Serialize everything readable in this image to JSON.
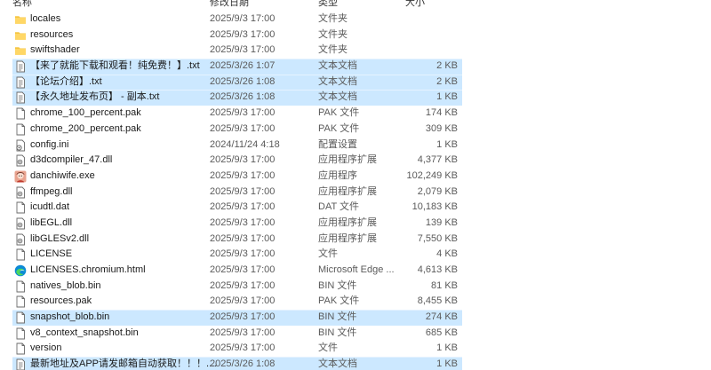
{
  "header": {
    "name_label": "名称",
    "date_label": "修改日期",
    "type_label": "类型",
    "size_label": "大小"
  },
  "colors": {
    "selection": "#cce8ff",
    "folder": "#f5c542",
    "text_secondary": "#5a5a5a"
  },
  "files": [
    {
      "name": "locales",
      "date": "2025/9/3 17:00",
      "type": "文件夹",
      "size": "",
      "icon": "folder-icon",
      "selected": false
    },
    {
      "name": "resources",
      "date": "2025/9/3 17:00",
      "type": "文件夹",
      "size": "",
      "icon": "folder-icon",
      "selected": false
    },
    {
      "name": "swiftshader",
      "date": "2025/9/3 17:00",
      "type": "文件夹",
      "size": "",
      "icon": "folder-icon",
      "selected": false
    },
    {
      "name": "【来了就能下载和观看！纯免费！】.txt",
      "date": "2025/3/26 1:07",
      "type": "文本文档",
      "size": "2 KB",
      "icon": "text-file-icon",
      "selected": true
    },
    {
      "name": "【论坛介绍】.txt",
      "date": "2025/3/26 1:08",
      "type": "文本文档",
      "size": "2 KB",
      "icon": "text-file-icon",
      "selected": true
    },
    {
      "name": "【永久地址发布页】 - 副本.txt",
      "date": "2025/3/26 1:08",
      "type": "文本文档",
      "size": "1 KB",
      "icon": "text-file-icon",
      "selected": true
    },
    {
      "name": "chrome_100_percent.pak",
      "date": "2025/9/3 17:00",
      "type": "PAK 文件",
      "size": "174 KB",
      "icon": "file-icon",
      "selected": false
    },
    {
      "name": "chrome_200_percent.pak",
      "date": "2025/9/3 17:00",
      "type": "PAK 文件",
      "size": "309 KB",
      "icon": "file-icon",
      "selected": false
    },
    {
      "name": "config.ini",
      "date": "2024/11/24 4:18",
      "type": "配置设置",
      "size": "1 KB",
      "icon": "config-file-icon",
      "selected": false
    },
    {
      "name": "d3dcompiler_47.dll",
      "date": "2025/9/3 17:00",
      "type": "应用程序扩展",
      "size": "4,377 KB",
      "icon": "dll-icon",
      "selected": false
    },
    {
      "name": "danchiwife.exe",
      "date": "2025/9/3 17:00",
      "type": "应用程序",
      "size": "102,249 KB",
      "icon": "app-icon",
      "selected": false
    },
    {
      "name": "ffmpeg.dll",
      "date": "2025/9/3 17:00",
      "type": "应用程序扩展",
      "size": "2,079 KB",
      "icon": "dll-icon",
      "selected": false
    },
    {
      "name": "icudtl.dat",
      "date": "2025/9/3 17:00",
      "type": "DAT 文件",
      "size": "10,183 KB",
      "icon": "file-icon",
      "selected": false
    },
    {
      "name": "libEGL.dll",
      "date": "2025/9/3 17:00",
      "type": "应用程序扩展",
      "size": "139 KB",
      "icon": "dll-icon",
      "selected": false
    },
    {
      "name": "libGLESv2.dll",
      "date": "2025/9/3 17:00",
      "type": "应用程序扩展",
      "size": "7,550 KB",
      "icon": "dll-icon",
      "selected": false
    },
    {
      "name": "LICENSE",
      "date": "2025/9/3 17:00",
      "type": "文件",
      "size": "4 KB",
      "icon": "file-icon",
      "selected": false
    },
    {
      "name": "LICENSES.chromium.html",
      "date": "2025/9/3 17:00",
      "type": "Microsoft Edge ...",
      "size": "4,613 KB",
      "icon": "edge-icon",
      "selected": false
    },
    {
      "name": "natives_blob.bin",
      "date": "2025/9/3 17:00",
      "type": "BIN 文件",
      "size": "81 KB",
      "icon": "file-icon",
      "selected": false
    },
    {
      "name": "resources.pak",
      "date": "2025/9/3 17:00",
      "type": "PAK 文件",
      "size": "8,455 KB",
      "icon": "file-icon",
      "selected": false
    },
    {
      "name": "snapshot_blob.bin",
      "date": "2025/9/3 17:00",
      "type": "BIN 文件",
      "size": "274 KB",
      "icon": "file-icon",
      "selected": true
    },
    {
      "name": "v8_context_snapshot.bin",
      "date": "2025/9/3 17:00",
      "type": "BIN 文件",
      "size": "685 KB",
      "icon": "file-icon",
      "selected": false
    },
    {
      "name": "version",
      "date": "2025/9/3 17:00",
      "type": "文件",
      "size": "1 KB",
      "icon": "file-icon",
      "selected": false
    },
    {
      "name": "最新地址及APP请发邮箱自动获取！！！....",
      "date": "2025/3/26 1:08",
      "type": "文本文档",
      "size": "1 KB",
      "icon": "text-file-icon",
      "selected": true
    }
  ]
}
